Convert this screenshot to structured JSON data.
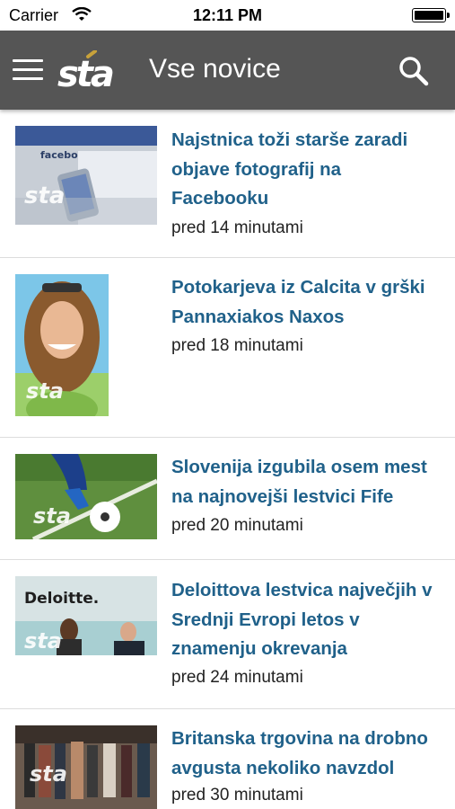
{
  "status": {
    "carrier": "Carrier",
    "time": "12:11 PM"
  },
  "nav": {
    "logo_text": "sta",
    "title": "Vse novice"
  },
  "articles": [
    {
      "title": "Najstnica toži starše zaradi objave fotografij na Facebooku",
      "time": "pred 14 minutami",
      "image_caption": "facebook"
    },
    {
      "title": "Potokarjeva iz Calcita v grški Pannaxiakos Naxos",
      "time": "pred 18 minutami"
    },
    {
      "title": "Slovenija izgubila osem mest na najnovejši lestvici Fife",
      "time": "pred 20 minutami"
    },
    {
      "title": "Deloittova lestvica največjih v Srednji Evropi letos v znamenju okrevanja",
      "time": "pred 24 minutami",
      "image_caption": "Deloitte."
    },
    {
      "title": "Britanska trgovina na drobno avgusta nekoliko navzdol",
      "time": "pred 30 minutami"
    }
  ],
  "watermark": "sta"
}
